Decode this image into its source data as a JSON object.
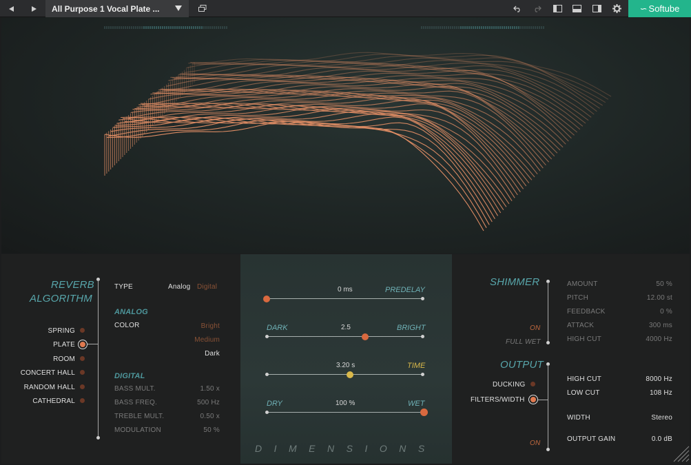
{
  "toolbar": {
    "back_icon": "triangle-left-icon",
    "forward_icon": "triangle-right-icon",
    "preset_name": "All Purpose 1 Vocal Plate ...",
    "preset_dropdown_icon": "chevron-down-icon",
    "copy_icon": "copy-window-icon",
    "undo_icon": "undo-icon",
    "redo_icon": "redo-icon",
    "layout_icons": [
      "panel-left-icon",
      "panel-bottom-icon",
      "panel-right-icon"
    ],
    "settings_icon": "gear-icon",
    "brand": "Softube"
  },
  "algorithm": {
    "title_line1": "REVERB",
    "title_line2": "ALGORITHM",
    "items": [
      "SPRING",
      "PLATE",
      "ROOM",
      "CONCERT HALL",
      "RANDOM HALL",
      "CATHEDRAL"
    ],
    "selected": "PLATE",
    "type_label": "TYPE",
    "type_options": [
      "Analog",
      "Digital"
    ],
    "type_selected": "Analog",
    "analog_header": "ANALOG",
    "color_label": "COLOR",
    "color_options": [
      "Bright",
      "Medium",
      "Dark"
    ],
    "color_selected": "Dark",
    "digital_header": "DIGITAL",
    "digital_params": [
      {
        "label": "BASS MULT.",
        "value": "1.50 x"
      },
      {
        "label": "BASS FREQ.",
        "value": "500 Hz"
      },
      {
        "label": "TREBLE MULT.",
        "value": "0.50 x"
      },
      {
        "label": "MODULATION",
        "value": "50 %"
      }
    ]
  },
  "center": {
    "predelay": {
      "value_text": "0 ms",
      "label": "PREDELAY",
      "position": 0.0
    },
    "tone": {
      "left_label": "DARK",
      "right_label": "BRIGHT",
      "value_text": "2.5",
      "position": 0.625
    },
    "time": {
      "value_text": "3.20 s",
      "label": "TIME",
      "position": 0.53
    },
    "mix": {
      "left_label": "DRY",
      "right_label": "WET",
      "value_text": "100 %",
      "position": 1.0
    },
    "logo": "DIMENSIONS",
    "colors": {
      "accent_orange": "#d9693f",
      "accent_yellow": "#d9b84a",
      "teal": "#6fb1b6"
    }
  },
  "shimmer": {
    "title": "SHIMMER",
    "on_label": "ON",
    "full_wet_label": "FULL WET",
    "params": [
      {
        "label": "AMOUNT",
        "value": "50 %"
      },
      {
        "label": "PITCH",
        "value": "12.00 st"
      },
      {
        "label": "FEEDBACK",
        "value": "0 %"
      },
      {
        "label": "ATTACK",
        "value": "300 ms"
      },
      {
        "label": "HIGH CUT",
        "value": "4000 Hz"
      }
    ]
  },
  "output": {
    "title": "OUTPUT",
    "ducking_label": "DUCKING",
    "filters_label": "FILTERS/WIDTH",
    "on_label": "ON",
    "params": [
      {
        "label": "HIGH CUT",
        "value": "8000 Hz"
      },
      {
        "label": "LOW CUT",
        "value": "108 Hz"
      },
      {
        "label": "WIDTH",
        "value": "Stereo"
      },
      {
        "label": "OUTPUT GAIN",
        "value": "0.0 dB"
      }
    ]
  }
}
